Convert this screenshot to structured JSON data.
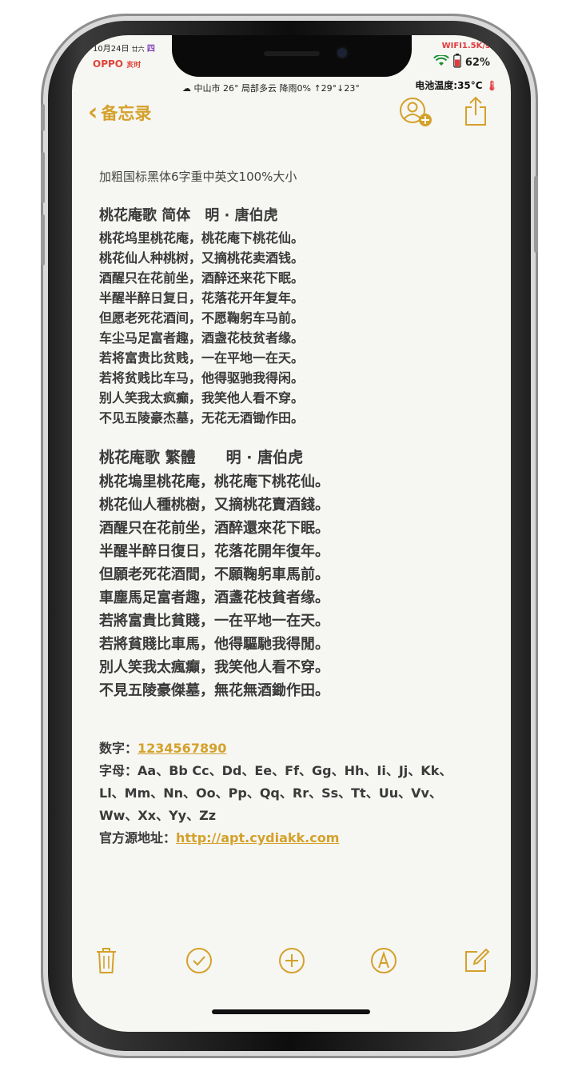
{
  "status": {
    "date": "10月24日",
    "weekday_small": "廿六",
    "weekday": "四",
    "brand": "OPPO",
    "brand_suffix": "亥时",
    "network": "WIFI1.5K/s",
    "battery": "62%",
    "weather": "中山市 26° 局部多云",
    "rain": "降雨0% ↑29°↓23°",
    "battery_temp": "电池温度:35°C"
  },
  "nav": {
    "back_label": "备忘录"
  },
  "note": {
    "meta": "加粗国标黑体6字重中英文100%大小",
    "simplified": {
      "title": "桃花庵歌 简体　明 · 唐伯虎",
      "lines": [
        "桃花坞里桃花庵，桃花庵下桃花仙。",
        "桃花仙人种桃树，又摘桃花卖酒钱。",
        "酒醒只在花前坐，酒醉还来花下眠。",
        "半醒半醉日复日，花落花开年复年。",
        "但愿老死花酒间，不愿鞠躬车马前。",
        "车尘马足富者趣，酒盏花枝贫者缘。",
        "若将富贵比贫贱，一在平地一在天。",
        "若将贫贱比车马，他得驱驰我得闲。",
        "别人笑我太疯癫，我笑他人看不穿。",
        "不见五陵豪杰墓，无花无酒锄作田。"
      ]
    },
    "traditional": {
      "title": "桃花庵歌 繁體　　明 · 唐伯虎",
      "lines": [
        "桃花塢里桃花庵，桃花庵下桃花仙。",
        "桃花仙人種桃樹，又摘桃花賣酒錢。",
        "酒醒只在花前坐，酒醉還來花下眠。",
        "半醒半醉日復日，花落花開年復年。",
        "但願老死花酒間，不願鞠躬車馬前。",
        "車塵馬足富者趣，酒盞花枝貧者缘。",
        "若將富貴比貧賤，一在平地一在天。",
        "若將貧賤比車馬，他得驅馳我得閒。",
        "別人笑我太瘋癲，我笑他人看不穿。",
        "不見五陵豪傑墓，無花無酒鋤作田。"
      ]
    },
    "digits_label": "数字：",
    "digits_value": "1234567890",
    "letters_label": "字母：",
    "letters_line1": "Aa、Bb Cc、Dd、Ee、Ff、Gg、Hh、Ii、Jj、Kk、",
    "letters_line2": "Ll、Mm、Nn、Oo、Pp、Qq、Rr、Ss、Tt、Uu、Vv、",
    "letters_line3": "Ww、Xx、Yy、Zz",
    "source_label": "官方源地址：",
    "source_url": "http://apt.cydiakk.com"
  },
  "colors": {
    "accent": "#d4a12a",
    "paper": "#f6f6f3",
    "text": "#3a3a3a"
  },
  "icons": {
    "add_person": "person-plus-icon",
    "share": "share-icon",
    "trash": "trash-icon",
    "checklist": "checkmark-circle-icon",
    "add": "plus-circle-icon",
    "markup": "pen-tip-circle-icon",
    "compose": "compose-icon"
  }
}
